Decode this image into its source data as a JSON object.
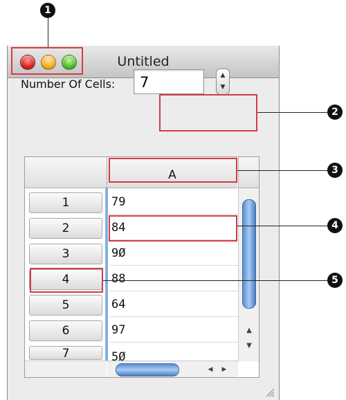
{
  "window": {
    "title": "Untitled",
    "traffic_lights": [
      "close",
      "minimize",
      "zoom"
    ]
  },
  "form": {
    "label": "Number Of Cells:",
    "value": "7",
    "stepper_up": "▲",
    "stepper_down": "▼"
  },
  "table": {
    "column_header": "A",
    "row_headers": [
      "1",
      "2",
      "3",
      "4",
      "5",
      "6",
      "7"
    ],
    "cells": [
      "79",
      "84",
      "9Ø",
      "88",
      "64",
      "97",
      "5Ø"
    ]
  },
  "scrollbar": {
    "up": "▲",
    "down": "▼",
    "left": "◀",
    "right": "▶"
  },
  "callouts": [
    "1",
    "2",
    "3",
    "4",
    "5"
  ],
  "colors": {
    "callout_box": "#d23b46",
    "selection_blue": "#7fb2e0",
    "scroll_thumb": "#5b8fd0"
  }
}
